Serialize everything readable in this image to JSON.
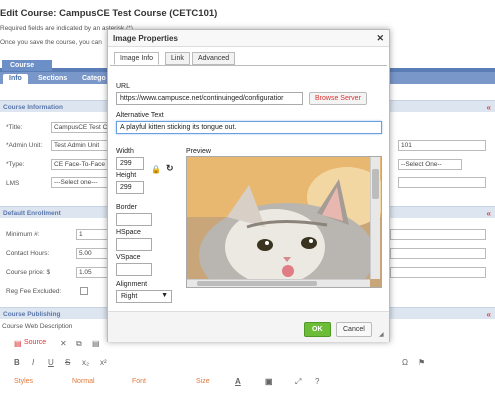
{
  "page": {
    "title": "Edit Course: CampusCE Test Course (CETC101)",
    "required_note": "Required fields are indicated by an asterisk (*)",
    "save_note": "Once you save the course, you can",
    "course_tab": "Course",
    "subtabs": [
      "Info",
      "Sections",
      "Catego"
    ]
  },
  "course_info": {
    "header": "Course Information",
    "fields": {
      "title_label": "*Title:",
      "title_value": "CampusCE Test C",
      "admin_label": "*Admin Unit:",
      "admin_value": "Test Admin Unit",
      "type_label": "*Type:",
      "type_value": "CE Face-To-Face",
      "lms_label": "LMS",
      "lms_value": "---Select one---",
      "right_value": "101",
      "right_select": "--Select One--"
    }
  },
  "enrollment": {
    "header": "Default Enrollment",
    "min_label": "Minimum #:",
    "min_value": "1",
    "contact_label": "Contact Hours:",
    "contact_value": "5.00",
    "price_label": "Course price: $",
    "price_value": "1.05",
    "regfee_label": "Reg Fee Excluded:"
  },
  "publishing": {
    "header": "Course Publishing",
    "description_label": "Course Web Description"
  },
  "editor": {
    "source_label": "Source",
    "styles_label": "Styles",
    "format_label": "Normal",
    "font_label": "Font",
    "size_label": "Size"
  },
  "dialog": {
    "title": "Image Properties",
    "tabs": [
      "Image Info",
      "Link",
      "Advanced"
    ],
    "url_label": "URL",
    "url_value": "https://www.campusce.net/continuinged/configuratior",
    "browse_label": "Browse Server",
    "alt_label": "Alternative Text",
    "alt_value": "A playful kitten sticking its tongue out.",
    "width_label": "Width",
    "width_value": "299",
    "height_label": "Height",
    "height_value": "299",
    "border_label": "Border",
    "hspace_label": "HSpace",
    "vspace_label": "VSpace",
    "alignment_label": "Alignment",
    "alignment_value": "Right",
    "preview_label": "Preview",
    "ok_label": "OK",
    "cancel_label": "Cancel"
  },
  "icons": [
    "close-icon",
    "lock-icon",
    "reset-icon",
    "chevron-up-icon",
    "resize-grip-icon"
  ],
  "colors": {
    "accent": "#5b7db5",
    "ok_green": "#6cbc38",
    "required_red": "#c00"
  }
}
